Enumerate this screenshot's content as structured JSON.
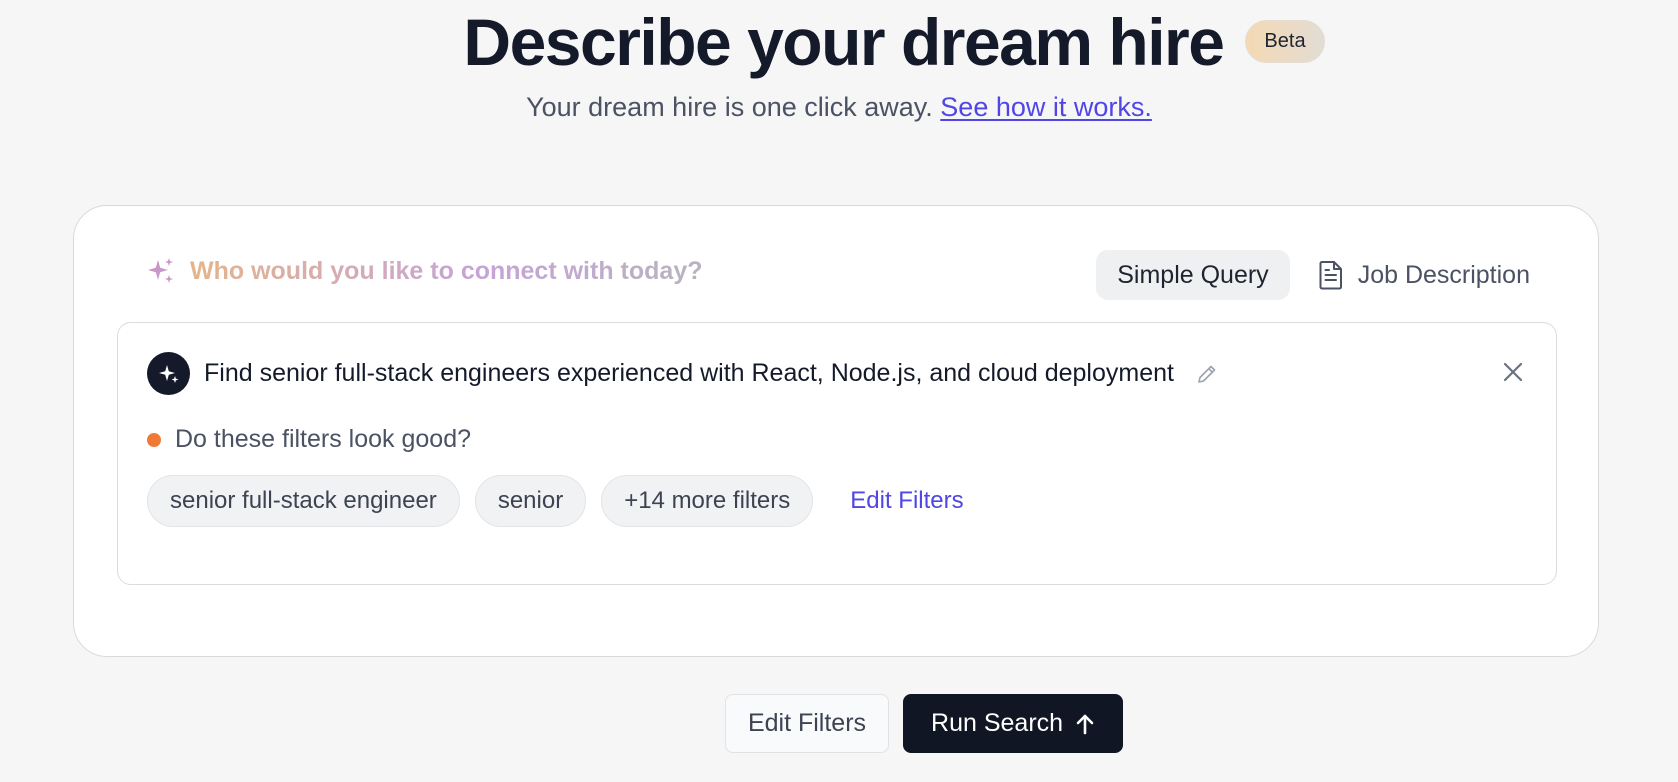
{
  "header": {
    "title": "Describe your dream hire",
    "badge": "Beta",
    "subtitle": "Your dream hire is one click away.",
    "subtitle_link": "See how it works."
  },
  "card": {
    "prompt": "Who would you like to connect with today?",
    "modes": {
      "simple_query": "Simple Query",
      "job_description": "Job Description"
    },
    "query": {
      "text": "Find senior full-stack engineers experienced with React, Node.js, and cloud deployment",
      "confirm_question": "Do these filters look good?",
      "chips": [
        "senior full-stack engineer",
        "senior",
        "+14 more filters"
      ],
      "edit_filters_link": "Edit Filters"
    }
  },
  "actions": {
    "edit_filters": "Edit Filters",
    "run_search": "Run Search"
  },
  "colors": {
    "accent": "#4f46e5",
    "status_dot": "#f07a35",
    "primary_button": "#111624"
  },
  "icons": {
    "prompt": "sparkle-icon",
    "job_description": "document-icon",
    "avatar": "sparkle-icon",
    "edit": "pencil-icon",
    "close": "close-icon",
    "run": "arrow-up-icon"
  }
}
